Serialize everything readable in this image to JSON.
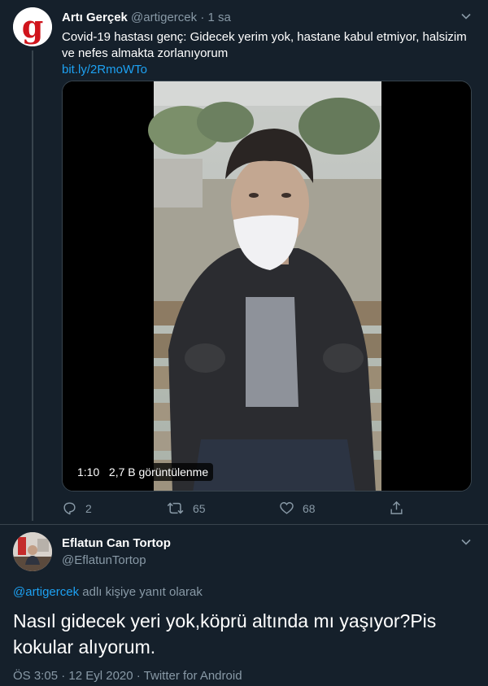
{
  "tweet1": {
    "author_name": "Artı Gerçek",
    "handle": "@artigercek",
    "separator": "·",
    "time": "1 sa",
    "avatar_letter": "g",
    "text": "Covid-19 hastası genç: Gidecek yerim yok, hastane kabul etmiyor, halsizim ve nefes almakta zorlanıyorum",
    "link": "bit.ly/2RmoWTo",
    "video": {
      "duration": "1:10",
      "views": "2,7 B görüntülenme"
    },
    "actions": {
      "reply_count": "2",
      "retweet_count": "65",
      "like_count": "68"
    }
  },
  "tweet2": {
    "author_name": "Eflatun Can Tortop",
    "handle": "@EflatunTortop",
    "reply_to_user": "@artigercek",
    "reply_to_suffix": "adlı kişiye yanıt olarak",
    "text": "Nasıl gidecek yeri yok,köprü altında mı yaşıyor?Pis kokular alıyorum.",
    "meta": "ÖS 3:05 · 12 Eyl 2020 · Twitter for Android"
  },
  "colors": {
    "background": "#15202b",
    "secondary_text": "#8899a6",
    "accent": "#1da1f2",
    "border": "#38444d"
  }
}
